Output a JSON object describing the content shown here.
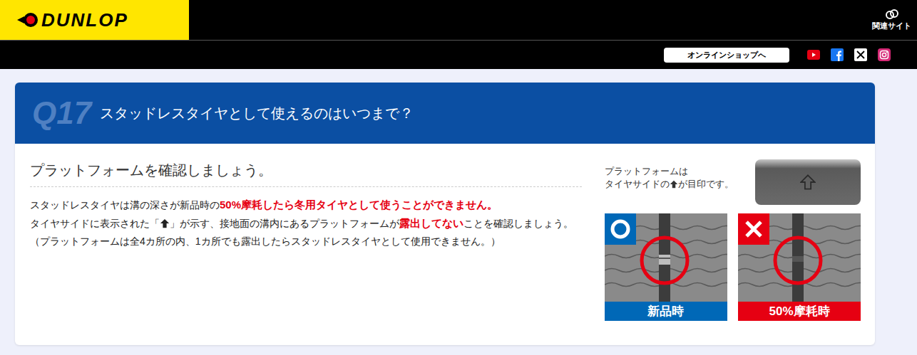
{
  "header": {
    "logo": "DUNLOP",
    "related_link": "関連サイト",
    "shop_button": "オンラインショップへ",
    "social": [
      {
        "kind": "youtube",
        "color": "#e60012"
      },
      {
        "kind": "facebook",
        "color": "#1877f2"
      },
      {
        "kind": "x",
        "color": "#ffffff"
      },
      {
        "kind": "instagram",
        "color": "#d62976"
      }
    ]
  },
  "faq": {
    "number": "Q17",
    "question": "スタッドレスタイヤとして使えるのはいつまで？",
    "heading": "プラットフォームを確認しましょう。",
    "paragraphs": [
      [
        {
          "kind": "text",
          "text": "スタッドレスタイヤは溝の深さが新品時の"
        },
        {
          "kind": "em",
          "text": "50%摩耗したら冬用タイヤとして使うことができません。"
        }
      ],
      [
        {
          "kind": "text",
          "text": "タイヤサイドに表示された「"
        },
        {
          "kind": "icon",
          "text": ""
        },
        {
          "kind": "text",
          "text": "」が示す、接地面の溝内にあるプラットフォームが"
        },
        {
          "kind": "em",
          "text": "露出してない"
        },
        {
          "kind": "text",
          "text": "ことを確認しましょう。"
        }
      ],
      [
        {
          "kind": "text",
          "text": "（プラットフォームは全4カ所の内、1カ所でも露出したらスタッドレスタイヤとして使用できません。）"
        }
      ]
    ],
    "caption_line1": "プラットフォームは",
    "caption_line2_before": "タイヤサイドの",
    "caption_line2_after": "が目印です。",
    "panels": [
      {
        "kind": "ok",
        "label": "新品時",
        "color": "#0068b7"
      },
      {
        "kind": "ng",
        "label": "50%摩耗時",
        "color": "#e60012"
      }
    ]
  }
}
